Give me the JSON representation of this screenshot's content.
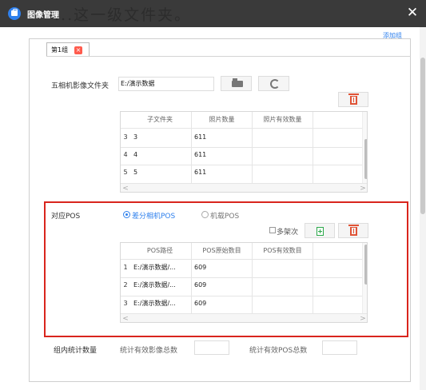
{
  "window": {
    "title": "图像管理",
    "ghost_text": "...这一级文件夹。",
    "close_symbol": "✕"
  },
  "header": {
    "add_group_label": "添加组"
  },
  "tab": {
    "label": "第1组",
    "close_symbol": "×"
  },
  "camera_folder": {
    "label": "五相机影像文件夹",
    "path": "E:/演示数据",
    "table": {
      "headers": [
        "子文件夹",
        "照片数量",
        "照片有效数量"
      ],
      "rows": [
        {
          "index": "3",
          "folder": "3",
          "count": "611",
          "valid": ""
        },
        {
          "index": "4",
          "folder": "4",
          "count": "611",
          "valid": ""
        },
        {
          "index": "5",
          "folder": "5",
          "count": "611",
          "valid": ""
        }
      ],
      "scroll_left": "<",
      "scroll_right": ">"
    }
  },
  "pos": {
    "label": "对应POS",
    "option_diff": "差分相机POS",
    "option_onboard": "机载POS",
    "multi_frame_label": "多架次",
    "table": {
      "headers": [
        "POS路径",
        "POS原始数目",
        "POS有效数目"
      ],
      "rows": [
        {
          "index": "1",
          "path": "E:/演示数据/...",
          "raw": "609",
          "valid": ""
        },
        {
          "index": "2",
          "path": "E:/演示数据/...",
          "raw": "609",
          "valid": ""
        },
        {
          "index": "3",
          "path": "E:/演示数据/...",
          "raw": "609",
          "valid": ""
        }
      ],
      "scroll_left": "<",
      "scroll_right": ">"
    }
  },
  "stats": {
    "label": "组内统计数量",
    "image_total_label": "统计有效影像总数",
    "pos_total_label": "统计有效POS总数",
    "image_total_value": "",
    "pos_total_value": ""
  },
  "colors": {
    "titlebar": "#3a3a3a",
    "accent": "#2f80ed",
    "highlight": "#d9251d",
    "delete": "#e05336"
  }
}
